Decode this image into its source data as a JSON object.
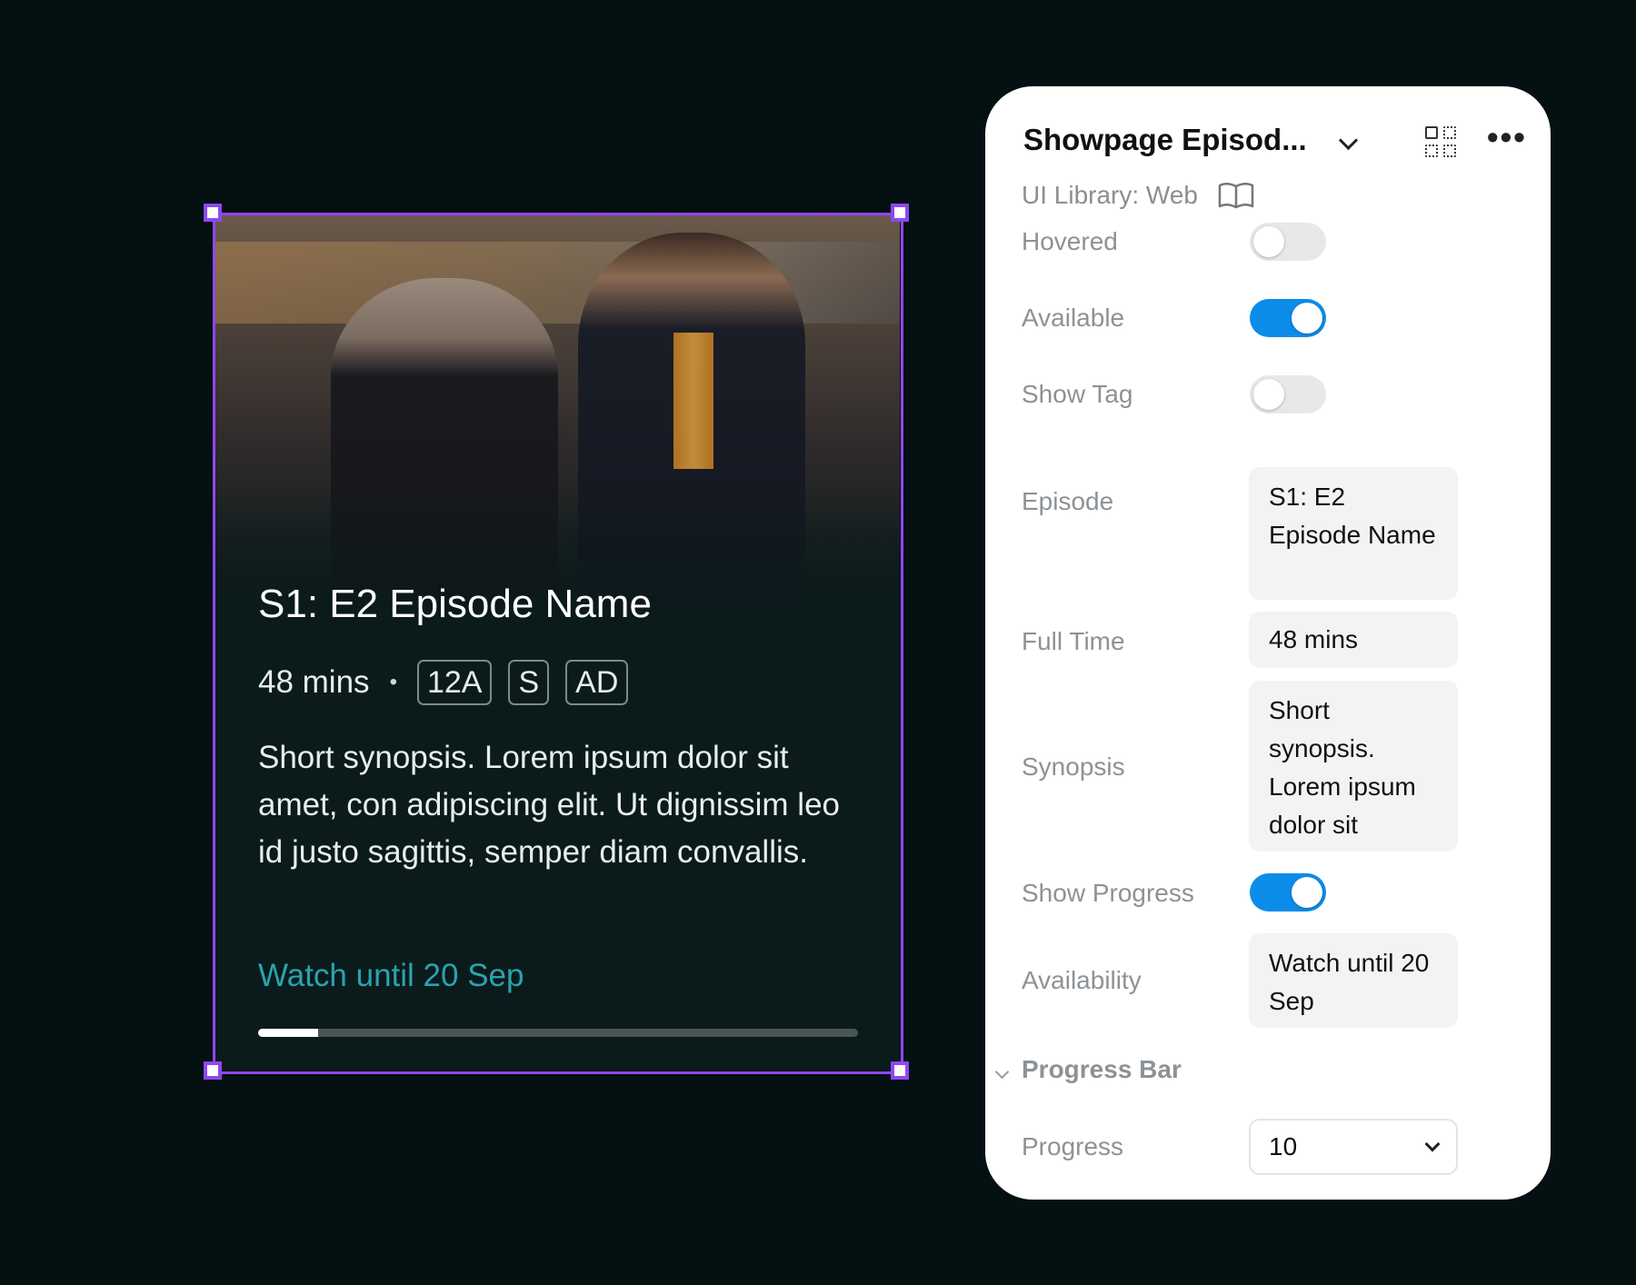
{
  "card": {
    "title": "S1: E2 Episode Name",
    "duration": "48 mins",
    "dot": "•",
    "badges": [
      "12A",
      "S",
      "AD"
    ],
    "synopsis": "Short synopsis. Lorem ipsum dolor sit amet, con adipiscing elit. Ut dignissim leo id justo sagittis, semper diam convallis.",
    "availability": "Watch until 20 Sep",
    "progress_percent": 10
  },
  "panel": {
    "title": "Showpage Episod...",
    "library": "UI Library: Web",
    "icons": {
      "title_dropdown": "chevron-down-icon",
      "variants": "component-grid-icon",
      "more": "more-icon",
      "library": "book-icon"
    },
    "more_glyph": "•••",
    "properties": {
      "hovered": {
        "label": "Hovered",
        "value": false
      },
      "available": {
        "label": "Available",
        "value": true
      },
      "show_tag": {
        "label": "Show Tag",
        "value": false
      },
      "episode": {
        "label": "Episode",
        "value": "S1: E2 Episode Name"
      },
      "full_time": {
        "label": "Full Time",
        "value": "48 mins"
      },
      "synopsis": {
        "label": "Synopsis",
        "value": "Short synopsis. Lorem ipsum dolor sit"
      },
      "show_progress": {
        "label": "Show Progress",
        "value": true
      },
      "availability": {
        "label": "Availability",
        "value": "Watch until 20 Sep"
      }
    },
    "progress_section": {
      "title": "Progress Bar",
      "progress_label": "Progress",
      "progress_value": "10"
    }
  },
  "colors": {
    "background": "#041012",
    "selection": "#8f47f5",
    "toggle_on": "#0c8ce9",
    "availability_text": "#2aa3ad"
  }
}
